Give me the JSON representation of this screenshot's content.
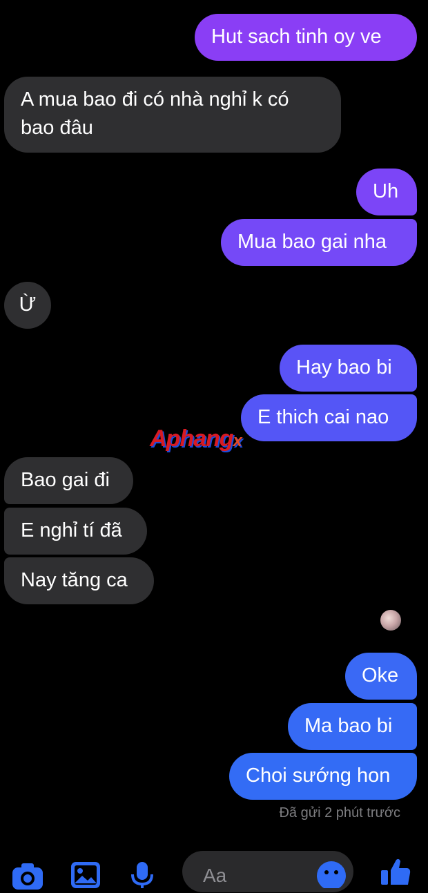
{
  "messages": [
    {
      "id": "m1",
      "side": "sent",
      "text": "Hut sach tinh oy ve",
      "color": "#8a3ef5"
    },
    {
      "id": "m2",
      "side": "received",
      "text": "A mua bao đi có nhà nghỉ k có bao đâu"
    },
    {
      "id": "m3",
      "side": "sent",
      "text": "Uh",
      "color": "#7c45f7"
    },
    {
      "id": "m4",
      "side": "sent",
      "text": "Mua bao gai nha",
      "color": "#7549f7"
    },
    {
      "id": "m5",
      "side": "received",
      "text": "Ừ"
    },
    {
      "id": "m6",
      "side": "sent",
      "text": "Hay bao bi",
      "color": "#5a53f6"
    },
    {
      "id": "m7",
      "side": "sent",
      "text": "E thich cai nao",
      "color": "#5456f6"
    },
    {
      "id": "m8",
      "side": "received",
      "text": "Bao gai đi"
    },
    {
      "id": "m9",
      "side": "received",
      "text": "E nghỉ tí đã"
    },
    {
      "id": "m10",
      "side": "received",
      "text": "Nay tăng ca"
    },
    {
      "id": "m11",
      "side": "sent",
      "text": "Oke",
      "color": "#3a69f5"
    },
    {
      "id": "m12",
      "side": "sent",
      "text": "Ma bao bi",
      "color": "#366af5"
    },
    {
      "id": "m13",
      "side": "sent",
      "text": "Choi sướng hon",
      "color": "#336cf5"
    }
  ],
  "status": "Đã gửi 2 phút trước",
  "watermark": {
    "main": "Aphang",
    "x": "x"
  },
  "composer": {
    "placeholder": "Aa"
  },
  "toolbar": {
    "icons": [
      "camera-icon",
      "gallery-icon",
      "microphone-icon",
      "emoji-icon",
      "thumbs-up-icon"
    ],
    "accent": "#2f6bf5"
  }
}
